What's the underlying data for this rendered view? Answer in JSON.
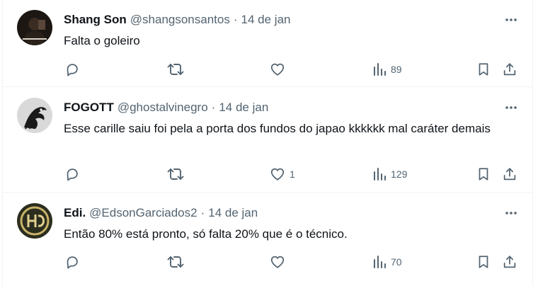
{
  "tweets": [
    {
      "name": "Shang Son",
      "handle": "@shangsonsantos",
      "separator": "·",
      "time": "14 de jan",
      "text": "Falta o goleiro",
      "replies": "",
      "retweets": "",
      "likes": "",
      "views": "89"
    },
    {
      "name": "FOGOTT",
      "handle": "@ghostalvinegro",
      "separator": "·",
      "time": "14 de jan",
      "text": "Esse carille saiu foi pela a porta dos fundos do japao kkkkkk mal caráter demais",
      "replies": "",
      "retweets": "",
      "likes": "1",
      "views": "129"
    },
    {
      "name": "Edi.",
      "handle": "@EdsonGarciados2",
      "separator": "·",
      "time": "14 de jan",
      "text": "Então 80% está pronto, só falta 20% que é o técnico.",
      "replies": "",
      "retweets": "",
      "likes": "",
      "views": "70"
    }
  ],
  "icons": {
    "reply": "reply-icon",
    "retweet": "retweet-icon",
    "like": "heart-icon",
    "views": "views-icon",
    "bookmark": "bookmark-icon",
    "share": "share-icon",
    "more": "more-dots-icon"
  },
  "colors": {
    "text": "#0f1419",
    "secondary": "#536471",
    "divider": "#eff3f4"
  }
}
